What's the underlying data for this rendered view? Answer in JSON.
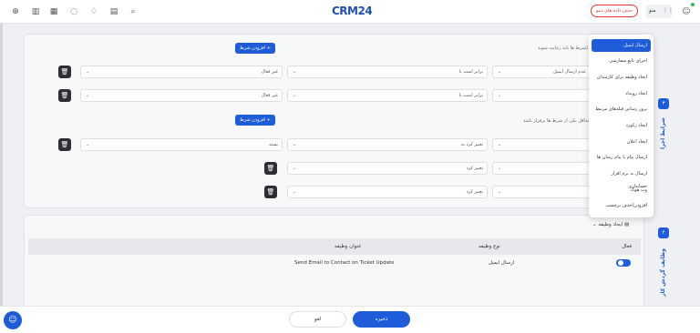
{
  "topbar": {
    "logo": "CRM24",
    "demo_button": "حذف داده های دمو",
    "menu_label": "منو",
    "icons": [
      "plus-circle-icon",
      "building-icon",
      "calendar-icon",
      "chat-icon",
      "bell-icon",
      "clipboard-icon",
      "search-icon",
      "grid-icon",
      "user-icon"
    ]
  },
  "conditions": {
    "section_hint_1": "شرط ها باید رعایت شوند)",
    "section_hint_2": "حداقل یکی از شرط ها برقرار باشد)",
    "add_condition_label": "افزودن شرط +",
    "rows": [
      {
        "field": "عدم ارسال ایمیل",
        "operator": "برابر است با",
        "value": "غیر فعال"
      },
      {
        "field": "",
        "operator": "برابر است با",
        "value": "غیر فعال"
      },
      {
        "field": "",
        "operator": "تغییر کرد به",
        "value": "بسته"
      },
      {
        "field": "",
        "operator": "تغییر کرد",
        "value": ""
      },
      {
        "field": "",
        "operator": "تغییر کرد",
        "value": ""
      }
    ]
  },
  "dropdown": {
    "items": [
      "ارسال ایمیل",
      "اجرای تابع سفارشی",
      "ایجاد وظیفه برای کارمندان",
      "ایجاد رویداد",
      "بروز رسانی فیلدهای مرتبط",
      "ایجاد رکورد",
      "ایجاد اعلان",
      "ارسال پیام با پیام رسان ها",
      "ارسال به نرم افزار حسابداری",
      "وب هوک",
      "افزودن/حذف برچسب"
    ],
    "active_index": 0
  },
  "sidebar_steps": {
    "step3_label": "شرایط اجرا",
    "step3_number": "۳",
    "step4_label": "وظایف گردش کار",
    "step4_number": "۴"
  },
  "tasks": {
    "create_task_label": "ایجاد وظیفه",
    "headers": {
      "active": "فعال",
      "task_type": "نوع وظیفه",
      "task_title": "عنوان وظیفه"
    },
    "rows": [
      {
        "active": true,
        "task_type": "ارسال ایمیل",
        "task_title": "Send Email to Contact on Ticket Update"
      }
    ]
  },
  "footer": {
    "cancel_label": "لغو",
    "save_label": "ذخیره"
  }
}
